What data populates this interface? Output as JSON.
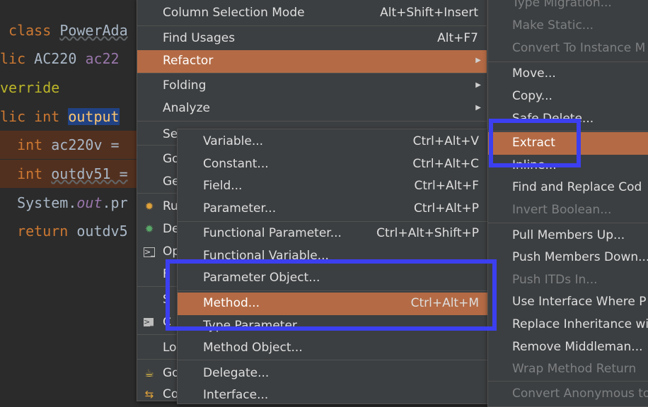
{
  "code": {
    "l1_kw": "class",
    "l1_cls": "PowerAda",
    "l2_kw": "lic",
    "l2_cls": "AC220",
    "l2_var": "ac22",
    "l3_ann": "verride",
    "l4_kw1": "lic",
    "l4_kw2": "int",
    "l4_mth": "output",
    "l5_kw": "int",
    "l5_rest": "ac220v =",
    "l6_kw": "int",
    "l6_rest": "outdv51 =",
    "l7_a": "System.",
    "l7_fld": "out",
    "l7_b": ".pr",
    "l8_kw": "return",
    "l8_rest": "outdv5"
  },
  "context_menu": {
    "items": [
      {
        "label": "Column Selection Mode",
        "shortcut": "Alt+Shift+Insert"
      },
      {
        "label": "Find Usages",
        "shortcut": "Alt+F7"
      },
      {
        "label": "Refactor"
      },
      {
        "label": "Folding"
      },
      {
        "label": "Analyze"
      },
      {
        "label": "Se"
      },
      {
        "label": "Go"
      },
      {
        "label": "Ge"
      },
      {
        "label": "Ru"
      },
      {
        "label": "De"
      },
      {
        "label": "Op"
      },
      {
        "label": "F"
      },
      {
        "label": "S"
      },
      {
        "label": "C"
      },
      {
        "label": "Lo"
      },
      {
        "label": "Go"
      },
      {
        "label": "Co"
      }
    ]
  },
  "extract_menu": {
    "items": [
      {
        "label": "Variable...",
        "shortcut": "Ctrl+Alt+V"
      },
      {
        "label": "Constant...",
        "shortcut": "Ctrl+Alt+C"
      },
      {
        "label": "Field...",
        "shortcut": "Ctrl+Alt+F"
      },
      {
        "label": "Parameter...",
        "shortcut": "Ctrl+Alt+P"
      },
      {
        "label": "Functional Parameter...",
        "shortcut": "Ctrl+Alt+Shift+P"
      },
      {
        "label": "Functional Variable..."
      },
      {
        "label": "Parameter Object..."
      },
      {
        "label": "Method...",
        "shortcut": "Ctrl+Alt+M"
      },
      {
        "label": "Type Parameter..."
      },
      {
        "label": "Method Object..."
      },
      {
        "label": "Delegate..."
      },
      {
        "label": "Interface..."
      }
    ]
  },
  "refactor_menu": {
    "items": [
      {
        "label": "Type Migration..."
      },
      {
        "label": "Make Static..."
      },
      {
        "label": "Convert To Instance M"
      },
      {
        "label": "Move..."
      },
      {
        "label": "Copy..."
      },
      {
        "label": "Safe Delete..."
      },
      {
        "label": "Extract"
      },
      {
        "label": "Inline..."
      },
      {
        "label": "Find and Replace Cod"
      },
      {
        "label": "Invert Boolean..."
      },
      {
        "label": "Pull Members Up..."
      },
      {
        "label": "Push Members Down..."
      },
      {
        "label": "Push ITDs In..."
      },
      {
        "label": "Use Interface Where P"
      },
      {
        "label": "Replace Inheritance wi"
      },
      {
        "label": "Remove Middleman..."
      },
      {
        "label": "Wrap Method Return"
      },
      {
        "label": "Convert Anonymous to"
      }
    ]
  },
  "colors": {
    "menu_bg": "#3c3f41",
    "selected": "#b46b45",
    "highlight_box": "#3c3ff0",
    "editor_bg": "#2b2b2b"
  }
}
